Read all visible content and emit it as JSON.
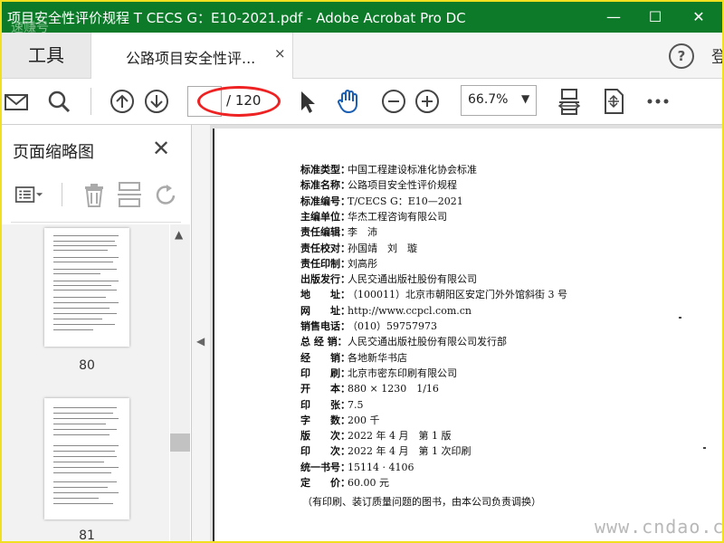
{
  "window": {
    "title": "项目安全性评价规程  T CECS G：E10-2021.pdf - Adobe Acrobat Pro DC",
    "minimize": "—",
    "maximize": "☐",
    "close": "✕"
  },
  "tabs": {
    "tools": "工具",
    "document": "公路项目安全性评...",
    "close": "×",
    "help": "?",
    "signin": "登"
  },
  "toolbar": {
    "page_current": "",
    "page_total": "/ 120",
    "zoom": "66.7%",
    "zoom_arrow": "▼"
  },
  "sidebar": {
    "title": "页面缩略图",
    "close": "✕",
    "thumbnails": [
      {
        "page": "80"
      },
      {
        "page": "81"
      }
    ]
  },
  "document": {
    "rows": [
      {
        "k": "标准类型：",
        "v": "中国工程建设标准化协会标准"
      },
      {
        "k": "标准名称：",
        "v": "公路项目安全性评价规程"
      },
      {
        "k": "标准编号：",
        "v": "T/CECS G：E10—2021"
      },
      {
        "k": "主编单位：",
        "v": "华杰工程咨询有限公司"
      },
      {
        "k": "责任编辑：",
        "v": "李　沛"
      },
      {
        "k": "责任校对：",
        "v": "孙国靖　刘　璇"
      },
      {
        "k": "责任印制：",
        "v": "刘高彤"
      },
      {
        "k": "出版发行：",
        "v": "人民交通出版社股份有限公司"
      },
      {
        "k": "地　　址：",
        "v": "（100011）北京市朝阳区安定门外外馆斜街 3 号"
      },
      {
        "k": "网　　址：",
        "v": "http://www.ccpcl.com.cn"
      },
      {
        "k": "销售电话：",
        "v": "（010）59757973"
      },
      {
        "k": "总 经 销：",
        "v": "人民交通出版社股份有限公司发行部"
      },
      {
        "k": "经　　销：",
        "v": "各地新华书店"
      },
      {
        "k": "印　　刷：",
        "v": "北京市密东印刷有限公司"
      },
      {
        "k": "开　　本：",
        "v": "880 × 1230　1/16"
      },
      {
        "k": "印　　张：",
        "v": "7.5"
      },
      {
        "k": "字　　数：",
        "v": "200 千"
      },
      {
        "k": "版　　次：",
        "v": "2022 年 4 月　第 1 版"
      },
      {
        "k": "印　　次：",
        "v": "2022 年 4 月　第 1 次印刷"
      },
      {
        "k": "统一书号：",
        "v": "15114 · 4106"
      },
      {
        "k": "定　　价：",
        "v": "60.00 元"
      }
    ],
    "note": "（有印刷、装订质量问题的图书，由本公司负责调换）"
  },
  "watermarks": {
    "top_left": "速赚号",
    "bottom_right": "www.cndao.com"
  },
  "colors": {
    "titlebar": "#0d7a2a",
    "border": "#f0e020",
    "highlight": "#e22222"
  }
}
